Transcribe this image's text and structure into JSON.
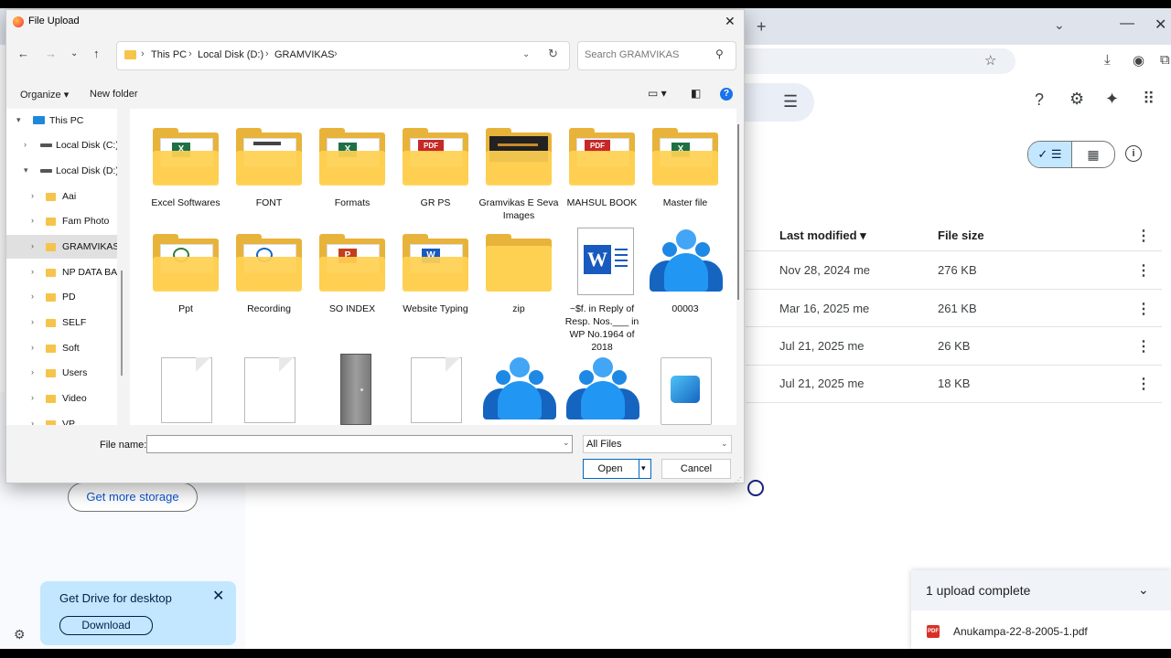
{
  "browser": {
    "new_tab_glyph": "+",
    "tab_list_glyph": "⌄",
    "minimize_glyph": "—",
    "close_glyph": "✕"
  },
  "drive": {
    "columns": {
      "last_modified": "Last modified ▾",
      "file_size": "File size"
    },
    "rows": [
      {
        "modified": "Nov 28, 2024 me",
        "size": "276 KB"
      },
      {
        "modified": "Mar 16, 2025 me",
        "size": "261 KB"
      },
      {
        "modified": "Jul 21, 2025 me",
        "size": "26 KB"
      },
      {
        "modified": "Jul 21, 2025 me",
        "size": "18 KB"
      }
    ],
    "storage_button": "Get more storage",
    "promo": {
      "title": "Get Drive for desktop",
      "button": "Download"
    },
    "upload_panel": {
      "title": "1 upload complete",
      "file": "Anukampa-22-8-2005-1.pdf"
    },
    "accent_color": "#c2e7ff"
  },
  "dialog": {
    "title": "File Upload",
    "breadcrumb": [
      "This PC",
      "Local Disk (D:)",
      "GRAMVIKAS"
    ],
    "search_placeholder": "Search GRAMVIKAS",
    "organize": "Organize ▾",
    "new_folder": "New folder",
    "tree": [
      {
        "label": "This PC",
        "kind": "pc"
      },
      {
        "label": "Local Disk (C:)",
        "kind": "drive"
      },
      {
        "label": "Local Disk (D:)",
        "kind": "drive"
      },
      {
        "label": "Aai",
        "kind": "folder"
      },
      {
        "label": "Fam Photo",
        "kind": "folder"
      },
      {
        "label": "GRAMVIKAS",
        "kind": "folder",
        "selected": true
      },
      {
        "label": "NP DATA BA",
        "kind": "folder"
      },
      {
        "label": "PD",
        "kind": "folder"
      },
      {
        "label": "SELF",
        "kind": "folder"
      },
      {
        "label": "Soft",
        "kind": "folder"
      },
      {
        "label": "Users",
        "kind": "folder"
      },
      {
        "label": "Video",
        "kind": "folder"
      },
      {
        "label": "VP",
        "kind": "folder"
      }
    ],
    "items": [
      {
        "label": "Excel Softwares",
        "icon": "excel-folder-icon"
      },
      {
        "label": "FONT",
        "icon": "font-folder-icon"
      },
      {
        "label": "Formats",
        "icon": "excel-folder-icon"
      },
      {
        "label": "GR PS",
        "icon": "pdf-folder-icon"
      },
      {
        "label": "Gramvikas E Seva Images",
        "icon": "image-folder-icon"
      },
      {
        "label": "MAHSUL BOOK",
        "icon": "pdf-folder-icon"
      },
      {
        "label": "Master file",
        "icon": "excel-folder-icon"
      },
      {
        "label": "Ppt",
        "icon": "picture-folder-icon"
      },
      {
        "label": "Recording",
        "icon": "picture-folder-icon"
      },
      {
        "label": "SO INDEX",
        "icon": "powerpoint-folder-icon"
      },
      {
        "label": "Website Typing",
        "icon": "word-folder-icon"
      },
      {
        "label": "zip",
        "icon": "folder-icon"
      },
      {
        "label": "~$f. in Reply of Resp. Nos.___ in WP No.1964 of 2018",
        "icon": "word-document-icon"
      },
      {
        "label": "00003",
        "icon": "people-icon"
      },
      {
        "label": "",
        "icon": "blank-file-icon"
      },
      {
        "label": "",
        "icon": "blank-file-icon"
      },
      {
        "label": "",
        "icon": "door-image-icon"
      },
      {
        "label": "",
        "icon": "blank-file-icon"
      },
      {
        "label": "",
        "icon": "people-icon"
      },
      {
        "label": "",
        "icon": "people-icon"
      },
      {
        "label": "",
        "icon": "photo-file-icon"
      }
    ],
    "file_name_label": "File name:",
    "file_name_value": "",
    "file_type": "All Files",
    "open": "Open",
    "cancel": "Cancel"
  }
}
